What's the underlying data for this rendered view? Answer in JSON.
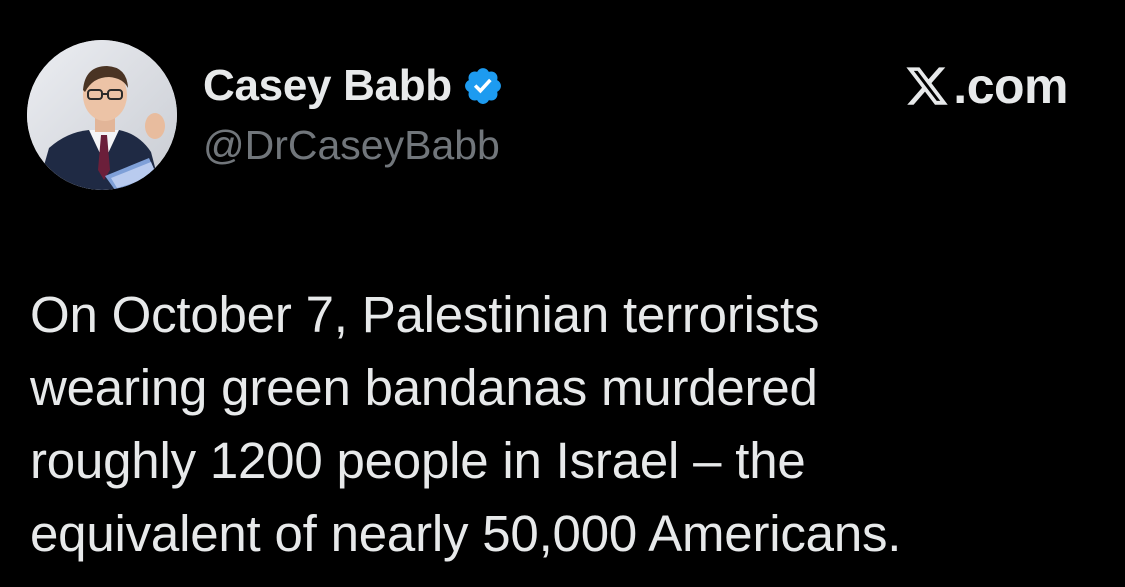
{
  "author": {
    "display_name": "Casey Babb",
    "handle": "@DrCaseyBabb",
    "verified": true,
    "verified_badge_color": "#1d9bf0"
  },
  "brand": {
    "suffix": ".com",
    "icon": "x-logo-icon"
  },
  "post": {
    "lines": [
      "On October 7, Palestinian terrorists",
      "wearing green bandanas murdered",
      "roughly 1200 people in Israel – the",
      "equivalent of nearly 50,000 Americans."
    ]
  },
  "colors": {
    "background": "#000000",
    "primary_text": "#e7e9ea",
    "secondary_text": "#71767b"
  }
}
